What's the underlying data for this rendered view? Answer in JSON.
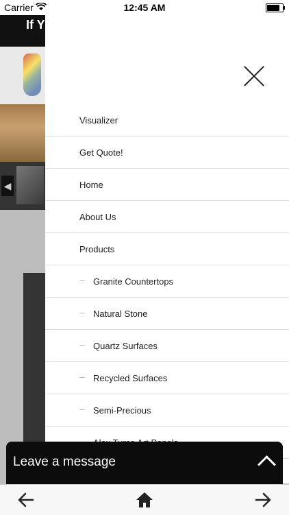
{
  "status_bar": {
    "carrier": "Carrier",
    "time": "12:45 AM"
  },
  "background_page": {
    "header_text": "If Y"
  },
  "menu": {
    "items": [
      {
        "label": "Visualizer",
        "sub": false
      },
      {
        "label": "Get Quote!",
        "sub": false
      },
      {
        "label": "Home",
        "sub": false
      },
      {
        "label": "About Us",
        "sub": false
      },
      {
        "label": "Products",
        "sub": false
      },
      {
        "label": "Granite Countertops",
        "sub": true
      },
      {
        "label": "Natural Stone",
        "sub": true
      },
      {
        "label": "Quartz Surfaces",
        "sub": true
      },
      {
        "label": "Recycled Surfaces",
        "sub": true
      },
      {
        "label": "Semi-Precious",
        "sub": true
      },
      {
        "label": "Alex Turco Art Panels",
        "sub": true
      }
    ]
  },
  "chat": {
    "label": "Leave a message"
  },
  "toolbar": {
    "icons": [
      "back-arrow-icon",
      "home-icon",
      "forward-arrow-icon"
    ]
  }
}
